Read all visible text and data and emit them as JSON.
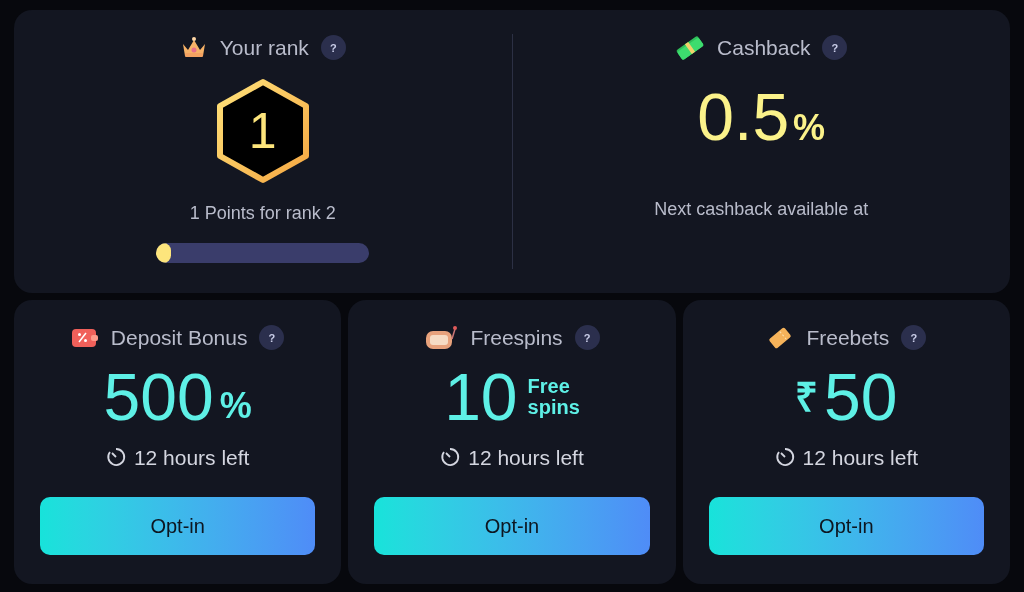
{
  "rank": {
    "title": "Your rank",
    "help": "?",
    "rank": "1",
    "points_text": "1 Points for rank 2",
    "progress": {
      "level": 0.07
    }
  },
  "cashback": {
    "title": "Cashback",
    "help": "?",
    "amount": "0.5",
    "suffix": "%",
    "note": "Next cashback available at"
  },
  "bonuses": [
    {
      "kind": "deposit",
      "title": "Deposit Bonus",
      "help": "?",
      "amount": "500",
      "suffix": "%",
      "time_left": "12 hours left",
      "button": "Opt-in"
    },
    {
      "kind": "freespins",
      "title": "Freespins",
      "help": "?",
      "amount": "10",
      "suffix_lines": [
        "Free",
        "spins"
      ],
      "time_left": "12 hours left",
      "button": "Opt-in"
    },
    {
      "kind": "freebets",
      "title": "Freebets",
      "help": "?",
      "prefix": "₹",
      "amount": "50",
      "time_left": "12 hours left",
      "button": "Opt-in"
    }
  ]
}
